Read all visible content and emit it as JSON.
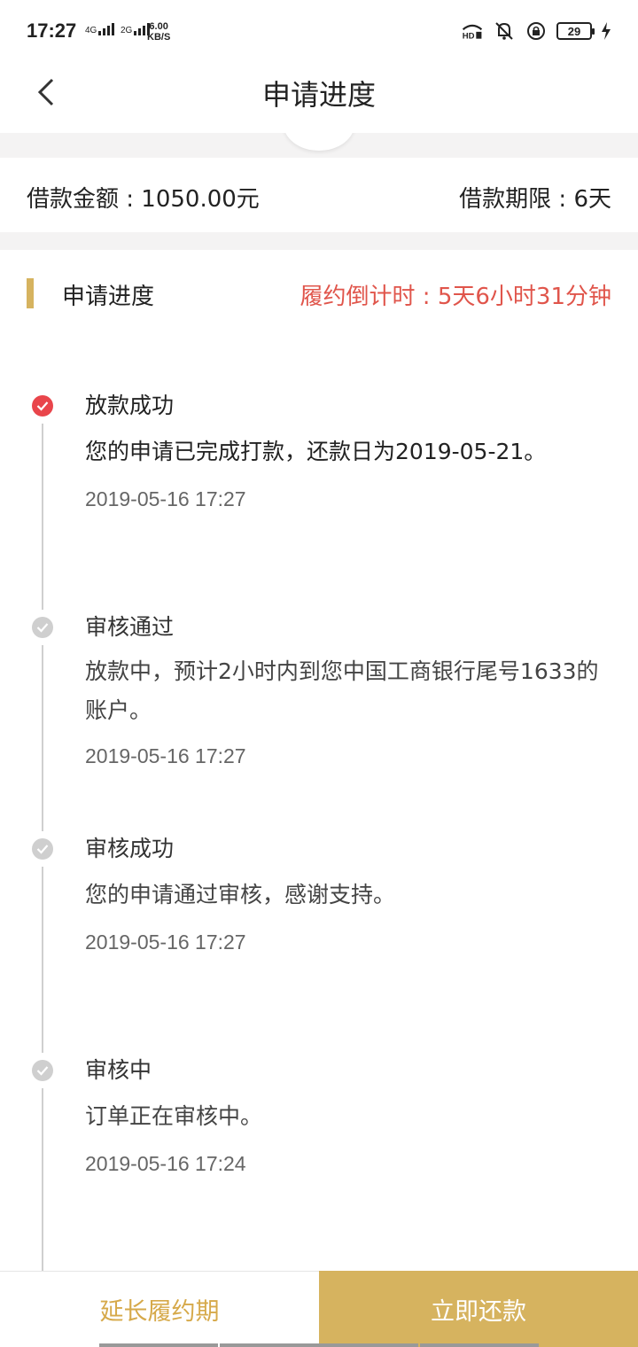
{
  "status_bar": {
    "time": "17:27",
    "network_1": "4G",
    "network_2": "2G",
    "speed_value": "6.00",
    "speed_unit": "KB/S",
    "battery": "29",
    "icons": [
      "hd-icon",
      "mute-icon",
      "lock-rotation-icon",
      "battery-icon",
      "charging-icon"
    ]
  },
  "nav": {
    "title": "申请进度"
  },
  "loan": {
    "amount_text": "借款金额 : 1050.00元",
    "term_text": "借款期限 : 6天"
  },
  "section": {
    "title": "申请进度",
    "countdown": "履约倒计时 : 5天6小时31分钟"
  },
  "timeline": [
    {
      "title": "放款成功",
      "desc": "您的申请已完成打款，还款日为2019-05-21。",
      "time": "2019-05-16 17:27",
      "state": "active"
    },
    {
      "title": "审核通过",
      "desc": "放款中，预计2小时内到您中国工商银行尾号1633的账户。",
      "time": "2019-05-16 17:27",
      "state": "done"
    },
    {
      "title": "审核成功",
      "desc": "您的申请通过审核，感谢支持。",
      "time": "2019-05-16 17:27",
      "state": "done"
    },
    {
      "title": "审核中",
      "desc": "订单正在审核中。",
      "time": "2019-05-16 17:24",
      "state": "done"
    }
  ],
  "buttons": {
    "extend": "延长履约期",
    "repay": "立即还款"
  },
  "colors": {
    "accent_gold": "#d6b35f",
    "countdown_red": "#e0554b",
    "active_dot": "#e9454b",
    "inactive_dot": "#cfcfcf"
  }
}
